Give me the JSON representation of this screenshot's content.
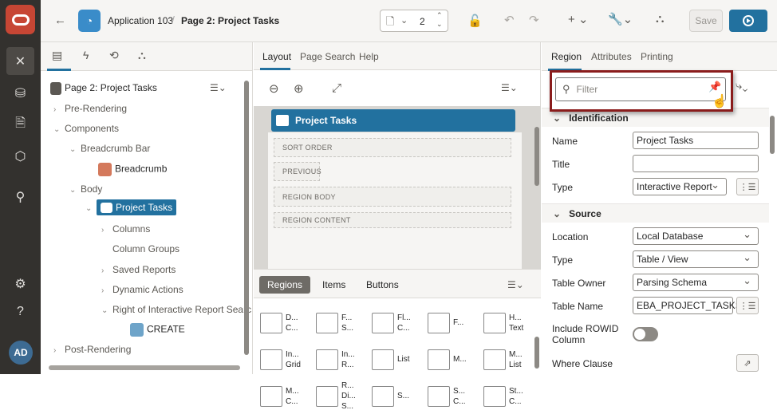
{
  "header": {
    "app_name": "Application 103",
    "page_title": "Page 2: Project Tasks",
    "page_number": "2",
    "save_label": "Save"
  },
  "left": {
    "root": "Page 2: Project Tasks",
    "tree": [
      {
        "label": "Pre-Rendering"
      },
      {
        "label": "Components"
      },
      {
        "label": "Breadcrumb Bar"
      },
      {
        "label": "Breadcrumb"
      },
      {
        "label": "Body"
      },
      {
        "label": "Project Tasks"
      },
      {
        "label": "Columns"
      },
      {
        "label": "Column Groups"
      },
      {
        "label": "Saved Reports"
      },
      {
        "label": "Dynamic Actions"
      },
      {
        "label": "Right of Interactive Report Searc"
      },
      {
        "label": "CREATE"
      },
      {
        "label": "Post-Rendering"
      }
    ]
  },
  "center": {
    "tabs": [
      "Layout",
      "Page Search",
      "Help"
    ],
    "region_title": "Project Tasks",
    "slots": [
      "SORT ORDER",
      "PREVIOUS",
      "REGION BODY",
      "REGION CONTENT"
    ],
    "gallery_tabs": [
      "Regions",
      "Items",
      "Buttons"
    ],
    "gallery": [
      {
        "l1": "D...",
        "l2": "C..."
      },
      {
        "l1": "F...",
        "l2": "S..."
      },
      {
        "l1": "Fl...",
        "l2": "C..."
      },
      {
        "l1": "F...",
        "l2": ""
      },
      {
        "l1": "H...",
        "l2": "Text"
      },
      {
        "l1": "In...",
        "l2": "Grid"
      },
      {
        "l1": "In...",
        "l2": "R..."
      },
      {
        "l1": "List",
        "l2": ""
      },
      {
        "l1": "M...",
        "l2": ""
      },
      {
        "l1": "M...",
        "l2": "List"
      },
      {
        "l1": "M...",
        "l2": "C..."
      },
      {
        "l1": "R...",
        "l2": "Di...",
        "l3": "S..."
      },
      {
        "l1": "S...",
        "l2": ""
      },
      {
        "l1": "S...",
        "l2": "C..."
      },
      {
        "l1": "St...",
        "l2": "C..."
      }
    ]
  },
  "right": {
    "tabs": [
      "Region",
      "Attributes",
      "Printing"
    ],
    "filter_placeholder": "Filter",
    "identification": "Identification",
    "source": "Source",
    "name_label": "Name",
    "name_value": "Project Tasks",
    "title_label": "Title",
    "title_value": "",
    "type_label": "Type",
    "type_value": "Interactive Report",
    "location_label": "Location",
    "location_value": "Local Database",
    "src_type_label": "Type",
    "src_type_value": "Table / View",
    "owner_label": "Table Owner",
    "owner_value": "Parsing Schema",
    "tname_label": "Table Name",
    "tname_value": "EBA_PROJECT_TASKS",
    "rowid_label": "Include ROWID Column",
    "where_label": "Where Clause"
  }
}
